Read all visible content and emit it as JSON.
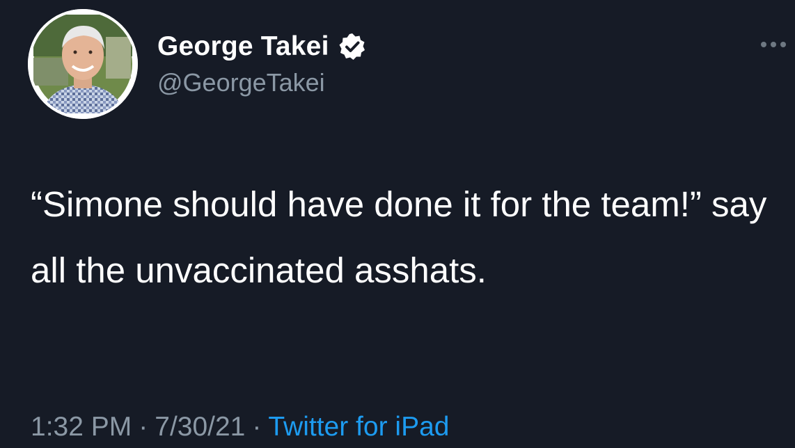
{
  "author": {
    "display_name": "George Takei",
    "handle": "@GeorgeTakei",
    "verified": true,
    "verified_icon": "verified-badge-icon",
    "avatar_icon": "profile-photo"
  },
  "menu": {
    "icon": "more-options-icon"
  },
  "tweet": {
    "text": "“Simone should have done it for the team!” say all the unvaccinated asshats."
  },
  "meta": {
    "time": "1:32 PM",
    "separator": "·",
    "date": "7/30/21",
    "source": "Twitter for iPad"
  },
  "colors": {
    "background": "#161b26",
    "text": "#ffffff",
    "secondary_text": "#8b98a5",
    "link": "#1d9bf0"
  }
}
